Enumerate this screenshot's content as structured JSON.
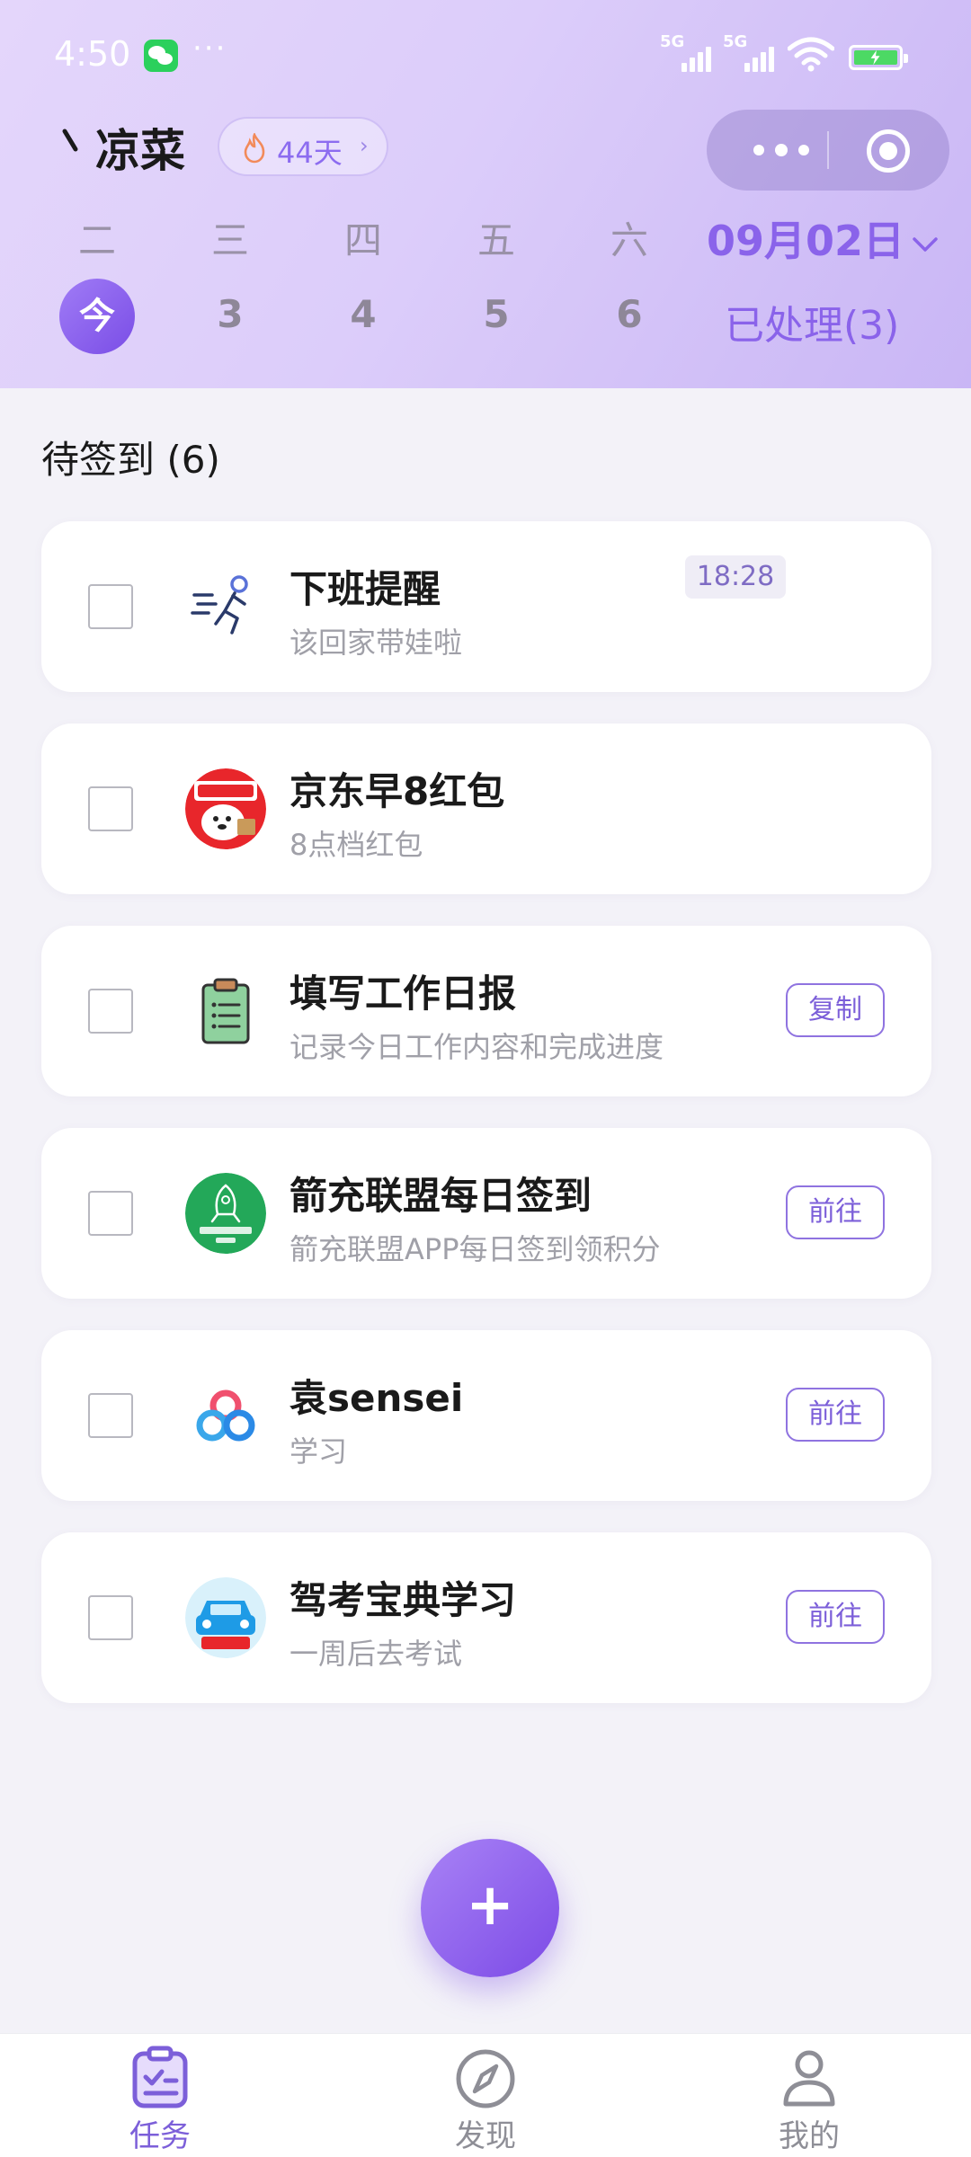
{
  "status_bar": {
    "time": "4:50",
    "dots": "···",
    "signal1_label": "5G",
    "signal2_label": "5G",
    "icons": [
      "wechat-icon",
      "signal-icon",
      "wifi-icon",
      "battery-charging-icon"
    ]
  },
  "header": {
    "title": "凉菜",
    "streak_label": "44天",
    "weekdays": [
      "二",
      "三",
      "四",
      "五",
      "六"
    ],
    "days": [
      "今",
      "3",
      "4",
      "5",
      "6"
    ],
    "date_label": "09月02日",
    "processed_label": "已处理(3)"
  },
  "section": {
    "title": "待签到 (6)"
  },
  "tasks": [
    {
      "title": "下班提醒",
      "subtitle": "该回家带娃啦",
      "time": "18:28",
      "action": "",
      "icon": "running-man-icon"
    },
    {
      "title": "京东早8红包",
      "subtitle": "8点档红包",
      "time": "",
      "action": "",
      "icon": "jd-takeout-icon"
    },
    {
      "title": "填写工作日报",
      "subtitle": "记录今日工作内容和完成进度",
      "time": "",
      "action": "复制",
      "icon": "clipboard-icon"
    },
    {
      "title": "箭充联盟每日签到",
      "subtitle": "箭充联盟APP每日签到领积分",
      "time": "",
      "action": "前往",
      "icon": "arrow-pro-icon"
    },
    {
      "title": "袁sensei",
      "subtitle": "学习",
      "time": "",
      "action": "前往",
      "icon": "baidu-netdisk-icon"
    },
    {
      "title": "驾考宝典学习",
      "subtitle": "一周后去考试",
      "time": "",
      "action": "前往",
      "icon": "driving-test-icon"
    }
  ],
  "fab": {
    "label": "+"
  },
  "tabbar": {
    "items": [
      {
        "label": "任务",
        "icon": "task-list-icon",
        "active": true
      },
      {
        "label": "发现",
        "icon": "compass-icon",
        "active": false
      },
      {
        "label": "我的",
        "icon": "profile-icon",
        "active": false
      }
    ]
  },
  "colors": {
    "accent": "#8a63ea",
    "active_tab": "#7c5fd9",
    "inactive_tab": "#8e8e96",
    "background": "#f3f2f8"
  }
}
